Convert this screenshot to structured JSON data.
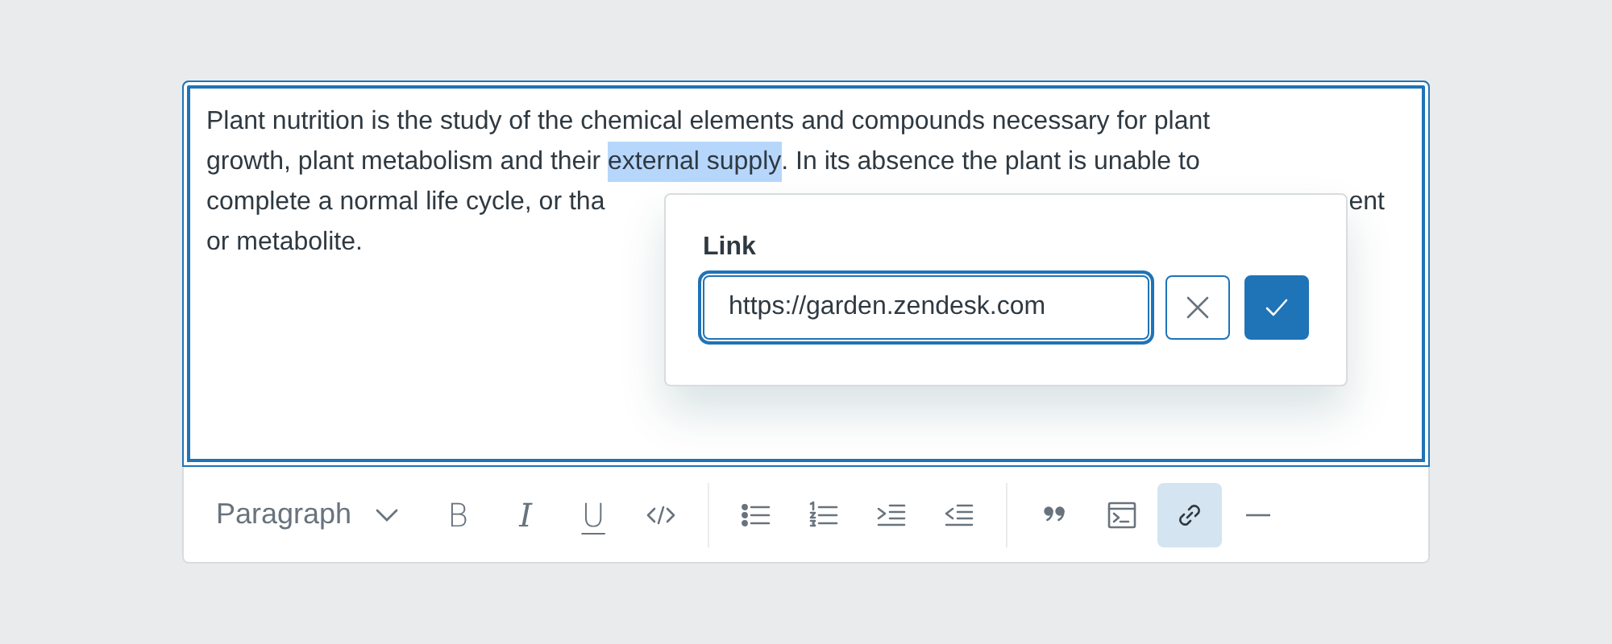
{
  "editor": {
    "focused": true,
    "lines": [
      [
        {
          "text": "Plant nutrition is the study of the chemical elements and compounds necessary for plant",
          "selected": false,
          "after_gap": false
        }
      ],
      [
        {
          "text": "growth, plant metabolism and their ",
          "selected": false,
          "after_gap": false
        },
        {
          "text": "external supply",
          "selected": true,
          "after_gap": false
        },
        {
          "text": ". In its absence the plant is unable to",
          "selected": false,
          "after_gap": false
        }
      ],
      [
        {
          "text": "complete a normal life cycle, or tha",
          "selected": false,
          "after_gap": false
        },
        {
          "text": "ent",
          "selected": false,
          "after_gap": true
        }
      ],
      [
        {
          "text": "or metabolite.",
          "selected": false,
          "after_gap": false
        }
      ]
    ]
  },
  "link_popover": {
    "label": "Link",
    "value": "https://garden.zendesk.com",
    "buttons": [
      {
        "kind": "cancel"
      },
      {
        "kind": "confirm"
      }
    ]
  },
  "toolbar": {
    "groups": [
      [
        {
          "kind": "dropdown",
          "label": "Paragraph",
          "selected": false
        },
        {
          "kind": "bold",
          "label": "B",
          "selected": false
        },
        {
          "kind": "italic",
          "label": "I",
          "selected": false
        },
        {
          "kind": "underline",
          "label": "U",
          "selected": false
        },
        {
          "kind": "code",
          "selected": false
        }
      ],
      [
        {
          "kind": "bullet-list",
          "selected": false
        },
        {
          "kind": "numbered-list",
          "selected": false
        },
        {
          "kind": "indent",
          "selected": false
        },
        {
          "kind": "outdent",
          "selected": false
        }
      ],
      [
        {
          "kind": "quote",
          "selected": false
        },
        {
          "kind": "code-block",
          "selected": false
        },
        {
          "kind": "link",
          "selected": true
        },
        {
          "kind": "horizontal-rule",
          "selected": false
        }
      ]
    ]
  }
}
